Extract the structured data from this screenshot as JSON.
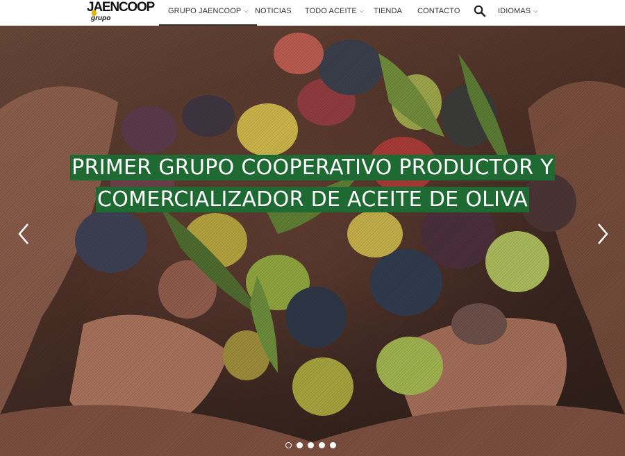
{
  "brand": {
    "name": "JAENCOOP",
    "sub": "grupo",
    "colors": {
      "accent_green": "#1f6a33",
      "drop_yellow": "#e3b600"
    }
  },
  "nav": {
    "items": [
      {
        "label": "GRUPO JAENCOOP",
        "has_dropdown": true,
        "active": true
      },
      {
        "label": "NOTICIAS",
        "has_dropdown": false
      },
      {
        "label": "TODO ACEITE",
        "has_dropdown": true
      },
      {
        "label": "TIENDA",
        "has_dropdown": false
      },
      {
        "label": "CONTACTO",
        "has_dropdown": false
      }
    ],
    "search_icon": "search-icon",
    "languages_label": "IDIOMAS",
    "chevron_glyph": "⌵"
  },
  "hero": {
    "headline_line1": "PRIMER GRUPO COOPERATIVO PRODUCTOR Y",
    "headline_line2": "COMERCIALIZADOR DE ACEITE DE OLIVA",
    "prev_icon": "chevron-left-icon",
    "next_icon": "chevron-right-icon",
    "slides_total": 5,
    "active_slide": 1
  }
}
